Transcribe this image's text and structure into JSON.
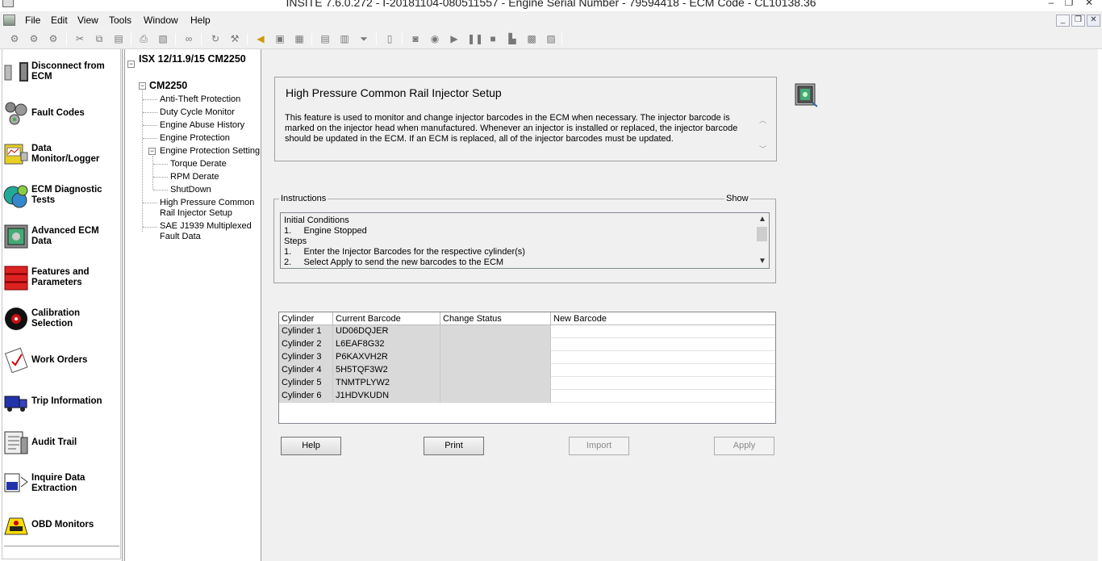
{
  "window": {
    "title": "INSITE 7.6.0.272 - I-20181104-080511557 - Engine Serial Number - 79594418 - ECM Code - CL10138.36",
    "minimize_glyph": "–",
    "restore_glyph": "❐",
    "close_glyph": "✕"
  },
  "menu": {
    "items": [
      "File",
      "Edit",
      "View",
      "Tools",
      "Window",
      "Help"
    ],
    "mdi_minimize": "_",
    "mdi_restore": "❐",
    "mdi_close": "✕"
  },
  "toolbar": {
    "icons": [
      "connect-icon",
      "disconnect-icon",
      "reconnect-icon",
      "cut-icon",
      "copy-icon",
      "paste-icon",
      "print-icon",
      "print-preview-icon",
      "find-icon",
      "refresh-icon",
      "settings-icon",
      "horn-icon",
      "monitor-icon",
      "snapshot-icon",
      "report-icon",
      "report-list-icon",
      "filter-icon",
      "page-icon",
      "camera-icon",
      "record-icon",
      "play-icon",
      "pause-icon",
      "stop-icon",
      "export-icon",
      "save-log-icon",
      "notes-icon"
    ]
  },
  "left_nav": {
    "items": [
      {
        "label": "Disconnect from ECM",
        "icon": "ecm-disconnect-icon"
      },
      {
        "label": "Fault Codes",
        "icon": "fault-codes-icon"
      },
      {
        "label": "Data Monitor/Logger",
        "icon": "data-monitor-icon"
      },
      {
        "label": "ECM Diagnostic Tests",
        "icon": "diagnostic-tests-icon"
      },
      {
        "label": "Advanced ECM Data",
        "icon": "advanced-ecm-data-icon"
      },
      {
        "label": "Features and Parameters",
        "icon": "features-parameters-icon"
      },
      {
        "label": "Calibration Selection",
        "icon": "calibration-disc-icon"
      },
      {
        "label": "Work Orders",
        "icon": "work-orders-icon"
      },
      {
        "label": "Trip Information",
        "icon": "truck-icon"
      },
      {
        "label": "Audit Trail",
        "icon": "audit-trail-icon"
      },
      {
        "label": "Inquire Data Extraction",
        "icon": "inquire-data-icon"
      },
      {
        "label": "OBD Monitors",
        "icon": "obd-icon"
      }
    ]
  },
  "tree": {
    "root": "ISX 12/11.9/15 CM2250",
    "child": "CM2250",
    "items": [
      "Anti-Theft Protection",
      "Duty Cycle Monitor",
      "Engine Abuse History",
      "Engine Protection",
      "Engine Protection Setting"
    ],
    "sub_items": [
      "Torque Derate",
      "RPM Derate",
      "ShutDown"
    ],
    "after_items": [
      "High Pressure Common Rail Injector Setup",
      "SAE J1939 Multiplexed Fault Data"
    ],
    "expander_glyph": "−"
  },
  "description": {
    "title": "High Pressure Common Rail Injector Setup",
    "body": "This feature is used to monitor and change injector barcodes in the ECM when necessary. The injector barcode is marked on the injector head when manufactured. Whenever an injector is installed or replaced, the injector barcode should be updated in the ECM. If an ECM is replaced, all of the injector barcodes must be updated.",
    "scroll_up": "︿",
    "scroll_down": "﹀"
  },
  "instructions": {
    "legend": "Instructions",
    "show_label": "Show",
    "lines": [
      "Initial Conditions",
      "1.     Engine Stopped",
      "Steps",
      "1.     Enter the Injector Barcodes for the respective cylinder(s)",
      "2.     Select Apply to send the new barcodes to the ECM"
    ],
    "scroll_up": "▲",
    "scroll_down": "▼"
  },
  "grid": {
    "columns": [
      "Cylinder",
      "Current Barcode",
      "Change Status",
      "New Barcode"
    ],
    "rows": [
      {
        "cylinder": "Cylinder 1",
        "current": "UD06DQJER",
        "status": "",
        "new": ""
      },
      {
        "cylinder": "Cylinder 2",
        "current": "L6EAF8G32",
        "status": "",
        "new": ""
      },
      {
        "cylinder": "Cylinder 3",
        "current": "P6KAXVH2R",
        "status": "",
        "new": ""
      },
      {
        "cylinder": "Cylinder 4",
        "current": "5H5TQF3W2",
        "status": "",
        "new": ""
      },
      {
        "cylinder": "Cylinder 5",
        "current": "TNMTPLYW2",
        "status": "",
        "new": ""
      },
      {
        "cylinder": "Cylinder 6",
        "current": "J1HDVKUDN",
        "status": "",
        "new": ""
      }
    ]
  },
  "buttons": {
    "help": "Help",
    "print": "Print",
    "import": "Import",
    "apply": "Apply"
  },
  "colors": {
    "readonly_cell": "#d9d9d9",
    "panel_bg": "#f0f0f0",
    "border": "#a0a0a0"
  }
}
